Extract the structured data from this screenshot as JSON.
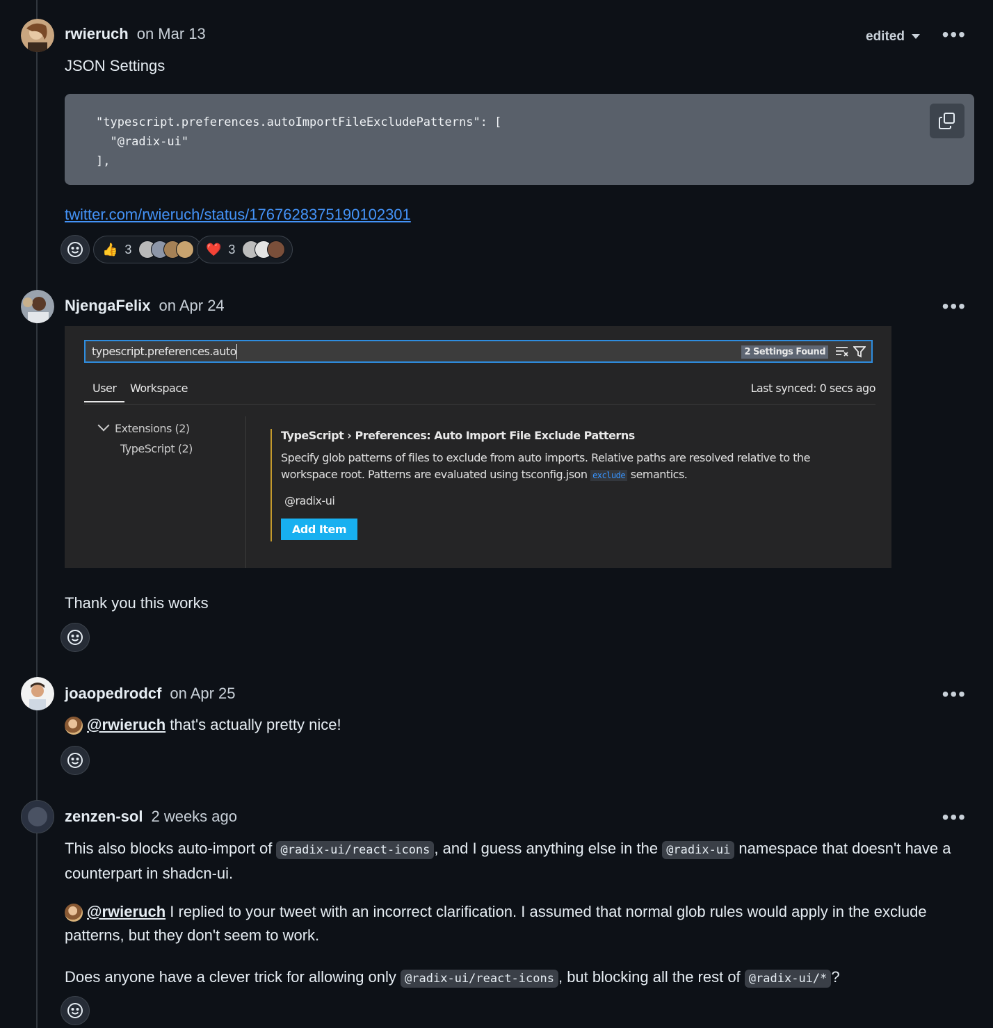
{
  "comments": [
    {
      "author": "rwieruch",
      "when": "on Mar 13",
      "edited_label": "edited",
      "body_title": "JSON Settings",
      "code": "\"typescript.preferences.autoImportFileExcludePatterns\": [\n  \"@radix-ui\"\n],",
      "link": "twitter.com/rwieruch/status/1767628375190102301",
      "reactions": [
        {
          "emoji": "👍",
          "count": "3"
        },
        {
          "emoji": "❤️",
          "count": "3"
        }
      ]
    },
    {
      "author": "NjengaFelix",
      "when": "on Apr 24",
      "body": "Thank you this works",
      "screenshot": {
        "search_value": "typescript.preferences.auto",
        "found_badge": "2 Settings Found",
        "tab_user": "User",
        "tab_workspace": "Workspace",
        "last_synced": "Last synced: 0 secs ago",
        "tree_extensions": "Extensions (2)",
        "tree_typescript": "TypeScript (2)",
        "setting_title": "TypeScript › Preferences: Auto Import File Exclude Patterns",
        "desc_part1": "Specify glob patterns of files to exclude from auto imports. Relative paths are resolved relative to the workspace root. Patterns are evaluated using tsconfig.json ",
        "desc_code": "exclude",
        "desc_part2": " semantics.",
        "item_value": "@radix-ui",
        "add_item_label": "Add Item"
      }
    },
    {
      "author": "joaopedrodcf",
      "when": "on Apr 25",
      "mention": "@rwieruch",
      "body": " that's actually pretty nice!"
    },
    {
      "author": "zenzen-sol",
      "when": "2 weeks ago",
      "p1_a": "This also blocks auto-import of ",
      "p1_code1": "@radix-ui/react-icons",
      "p1_b": ", and I guess anything else in the ",
      "p1_code2": "@radix-ui",
      "p1_c": " namespace that doesn't have a counterpart in shadcn-ui.",
      "p2_mention": "@rwieruch",
      "p2_text": " I replied to your tweet with an incorrect clarification. I assumed that normal glob rules would apply in the exclude patterns, but they don't seem to work.",
      "p3_a": "Does anyone have a clever trick for allowing only ",
      "p3_code1": "@radix-ui/react-icons",
      "p3_b": ", but blocking all the rest of ",
      "p3_code2": "@radix-ui/*",
      "p3_c": "?"
    }
  ],
  "icons": {
    "more": "kebab-horizontal-icon",
    "copy": "copy-icon",
    "smiley": "smiley-icon",
    "filter": "filter-icon",
    "clear": "clear-filter-icon",
    "chevron": "chevron-down-icon"
  },
  "colors": {
    "background": "#0d1117",
    "link": "#4493f8",
    "code_bg": "#59606a",
    "vscode_accent": "#18b0f0"
  }
}
